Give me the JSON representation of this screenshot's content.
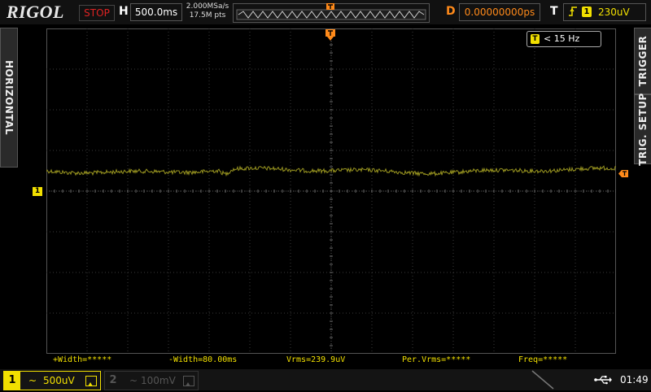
{
  "header": {
    "brand": "RIGOL",
    "run_state": "STOP",
    "h_label": "H",
    "timebase": "500.0ms",
    "sample_rate": "2.000MSa/s",
    "memory_depth": "17.5M pts",
    "d_label": "D",
    "delay": "0.00000000ps",
    "t_label": "T",
    "trigger_source": "1",
    "trigger_level": "230uV"
  },
  "side_tabs": {
    "left": "HORIZONTAL",
    "right_top": "TRIGGER",
    "right_bottom": "TRIG. SETUP"
  },
  "trigger_freq": {
    "icon": "T",
    "text": "< 15 Hz"
  },
  "markers": {
    "ch1": "1"
  },
  "measurements": [
    {
      "label": "+Width=*****"
    },
    {
      "label": "-Width=80.00ms"
    },
    {
      "label": "Vrms=239.9uV"
    },
    {
      "label": "Per.Vrms=*****"
    },
    {
      "label": "Freq=*****"
    }
  ],
  "channels": [
    {
      "num": "1",
      "coupling": "~",
      "scale": "500uV",
      "active": true
    },
    {
      "num": "2",
      "coupling": "~",
      "scale": "100mV",
      "active": false
    }
  ],
  "status": {
    "time": "01:49"
  },
  "colors": {
    "ch1": "#f2e000",
    "trace": "#9a9620",
    "trigger": "#ff8a1a",
    "stop": "#dd2222",
    "grid": "#3a3a3a"
  }
}
